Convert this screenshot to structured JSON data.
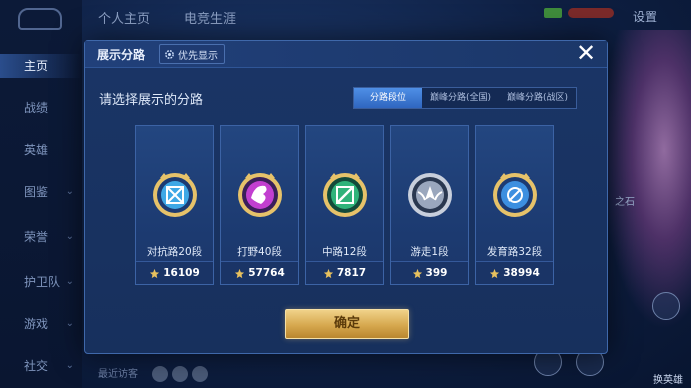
{
  "background": {
    "top_tabs": [
      "个人主页",
      "电竞生涯"
    ],
    "settings_label": "设置",
    "sidebar": [
      {
        "label": "主页",
        "active": true
      },
      {
        "label": "战绩",
        "active": false
      },
      {
        "label": "英雄",
        "active": false
      },
      {
        "label": "图鉴",
        "active": false
      },
      {
        "label": "荣誉",
        "active": false
      },
      {
        "label": "护卫队",
        "active": false
      },
      {
        "label": "游戏",
        "active": false
      },
      {
        "label": "社交",
        "active": false
      }
    ],
    "bottom_text": "最近访客",
    "rank_text": "之石",
    "hero_button": "换英雄"
  },
  "modal": {
    "title": "展示分路",
    "priority_label": "优先显示",
    "close_icon": "close-icon",
    "prompt": "请选择展示的分路",
    "tabs": [
      {
        "label": "分路段位",
        "active": true
      },
      {
        "label": "巅峰分路(全国)",
        "active": false
      },
      {
        "label": "巅峰分路(战区)",
        "active": false
      }
    ],
    "cards": [
      {
        "label": "对抗路20段",
        "score": "16109",
        "emblem": "sword-cross-emblem",
        "emblem_color": "#3ea8e6",
        "rim_color": "#e6c26a"
      },
      {
        "label": "打野40段",
        "score": "57764",
        "emblem": "jungle-beast-emblem",
        "emblem_color": "#c23fd0",
        "rim_color": "#e6c26a"
      },
      {
        "label": "中路12段",
        "score": "7817",
        "emblem": "mid-lane-emblem",
        "emblem_color": "#2fb37a",
        "rim_color": "#e6c26a"
      },
      {
        "label": "游走1段",
        "score": "399",
        "emblem": "roam-wings-emblem",
        "emblem_color": "#9aa7bd",
        "rim_color": "#c8cfdc"
      },
      {
        "label": "发育路32段",
        "score": "38994",
        "emblem": "bot-lane-emblem",
        "emblem_color": "#3c8fe0",
        "rim_color": "#e6c26a"
      }
    ],
    "confirm_label": "确定"
  },
  "colors": {
    "accent_tab": "#3f7ad6",
    "confirm_gold": "#d6a84e",
    "modal_bg": "#1a3566"
  }
}
